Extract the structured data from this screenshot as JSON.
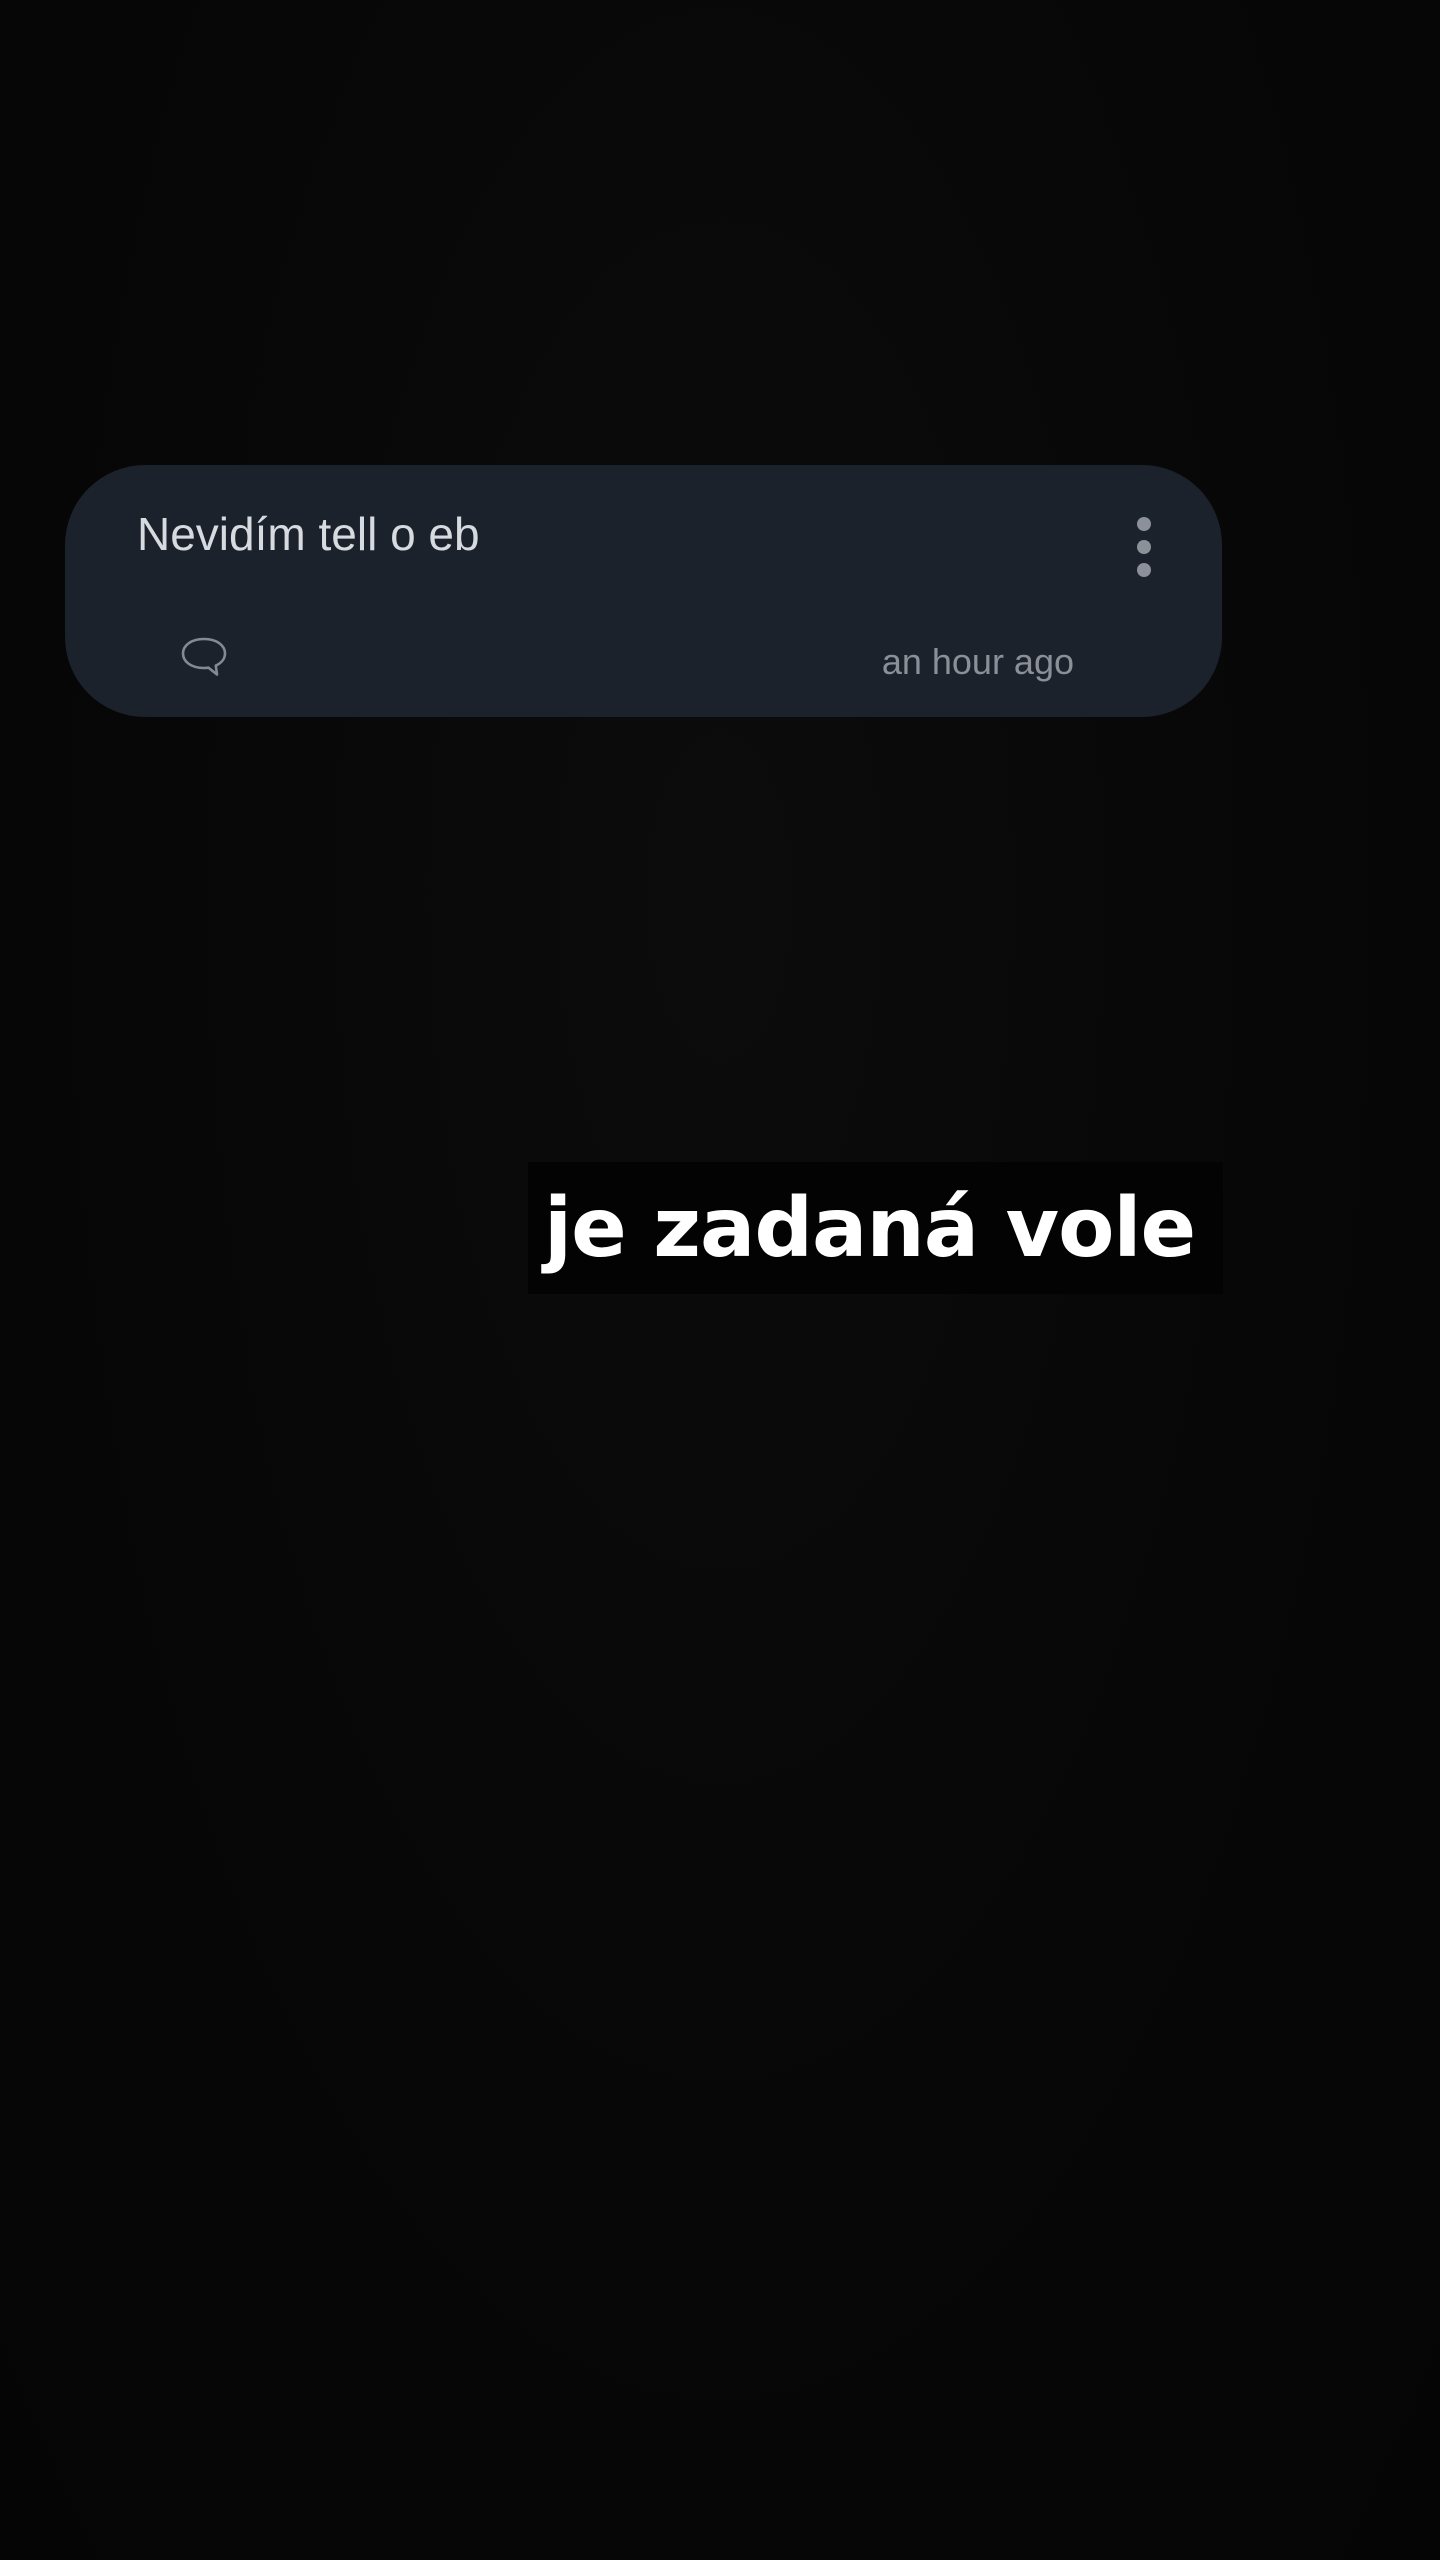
{
  "comment": {
    "text": "Nevidím tell o eb",
    "timestamp": "an hour ago",
    "menu_icon": "more-vertical-icon",
    "reply_icon": "speech-bubble-icon"
  },
  "caption": {
    "text": "je zadaná vole"
  },
  "colors": {
    "background": "#060606",
    "card": "#1c222c",
    "comment_text": "#d7dadf",
    "secondary_text": "#8b8f96",
    "caption_text": "#ffffff"
  }
}
